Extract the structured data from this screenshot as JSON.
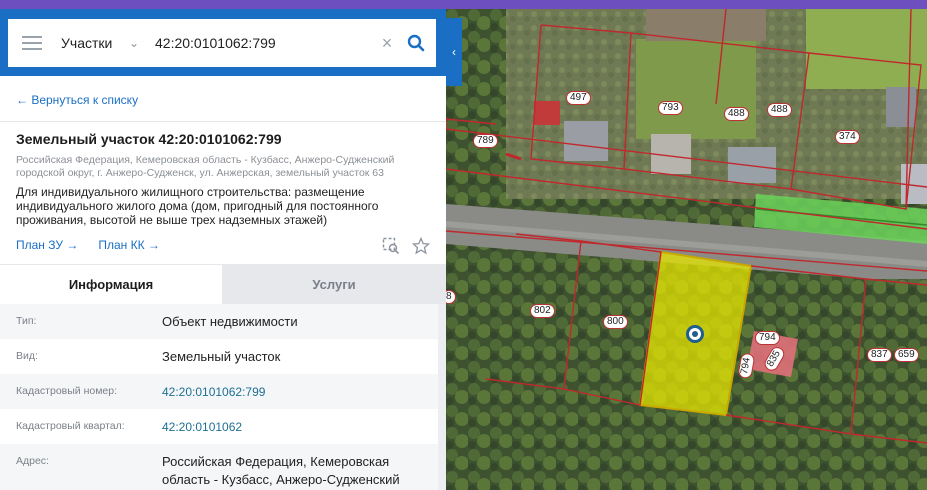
{
  "search": {
    "category": "Участки",
    "query": "42:20:0101062:799"
  },
  "back_link": "← Вернуться к списку",
  "parcel": {
    "title": "Земельный участок 42:20:0101062:799",
    "address_short": "Российская Федерация, Кемеровская область - Кузбасс, Анжеро-Судженский городской округ, г. Анжеро-Судженск, ул. Анжерская, земельный участок 63",
    "purpose": "Для индивидуального жилищного строительства: размещение индивидуального жилого дома (дом, пригодный для постоянного проживания, высотой не выше трех надземных этажей)",
    "links": [
      "План ЗУ →",
      "План КК →"
    ]
  },
  "tabs": [
    "Информация",
    "Услуги"
  ],
  "info_rows": [
    {
      "key": "Тип:",
      "value": "Объект недвижимости"
    },
    {
      "key": "Вид:",
      "value": "Земельный участок"
    },
    {
      "key": "Кадастровый номер:",
      "value": "42:20:0101062:799"
    },
    {
      "key": "Кадастровый квартал:",
      "value": "42:20:0101062"
    },
    {
      "key": "Адрес:",
      "value": "Российская Федерация, Кемеровская область - Кузбасс, Анжеро-Судженский"
    }
  ],
  "map_labels": [
    "497",
    "793",
    "488",
    "488",
    "374",
    "789",
    "802",
    "800",
    "794",
    "835",
    "794",
    "837",
    "659",
    "8"
  ],
  "colors": {
    "header_blue": "#1a6fc4",
    "selected_parcel": "#e6e600",
    "boundary": "#c0282d"
  }
}
